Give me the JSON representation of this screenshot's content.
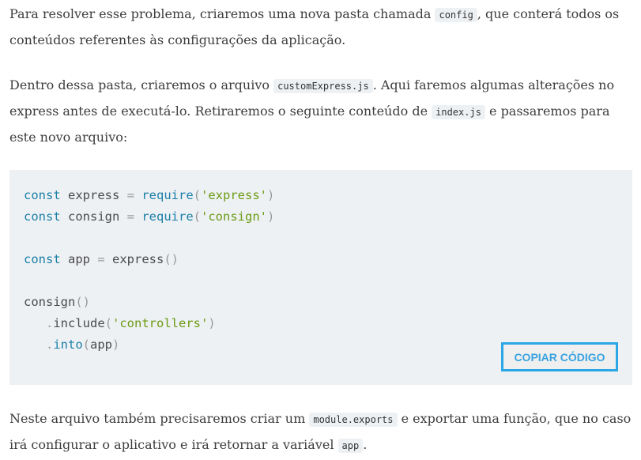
{
  "p1": {
    "a": "Para resolver esse problema, criaremos uma nova pasta chamada ",
    "c1": "config",
    "b": ", que conterá todos os conteúdos referentes às configurações da aplicação."
  },
  "p2": {
    "a": "Dentro dessa pasta, criaremos o arquivo ",
    "c1": "customExpress.js",
    "b": ". Aqui faremos algumas alterações no express antes de executá-lo. Retiraremos o seguinte conteúdo de ",
    "c2": "index.js",
    "c": " e passaremos para este novo arquivo:"
  },
  "code": [
    [
      [
        "kw",
        "const"
      ],
      [
        "",
        "  express "
      ],
      [
        "pun",
        "="
      ],
      [
        "",
        ""
      ],
      [
        "fn",
        " require"
      ],
      [
        "pun",
        "("
      ],
      [
        "str",
        "'express'"
      ],
      [
        "pun",
        ")"
      ]
    ],
    [
      [
        "kw",
        "const"
      ],
      [
        "",
        "  consign "
      ],
      [
        "pun",
        "="
      ],
      [
        "",
        ""
      ],
      [
        "fn",
        " require"
      ],
      [
        "pun",
        "("
      ],
      [
        "str",
        "'consign'"
      ],
      [
        "pun",
        ")"
      ]
    ],
    [],
    [
      [
        "kw",
        "const"
      ],
      [
        "",
        " app "
      ],
      [
        "pun",
        "="
      ],
      [
        "",
        " express"
      ],
      [
        "pun",
        "()"
      ]
    ],
    [],
    [
      [
        "",
        "consign"
      ],
      [
        "pun",
        "()"
      ]
    ],
    [
      [
        "pun",
        "    ."
      ],
      [
        "",
        "include"
      ],
      [
        "pun",
        "("
      ],
      [
        "str",
        "'controllers'"
      ],
      [
        "pun",
        ")"
      ]
    ],
    [
      [
        "pun",
        "    ."
      ],
      [
        "fn",
        "into"
      ],
      [
        "pun",
        "("
      ],
      [
        "",
        "app"
      ],
      [
        "pun",
        ")"
      ]
    ]
  ],
  "copy_label": "COPIAR CÓDIGO",
  "p3": {
    "a": "Neste arquivo também precisaremos criar um ",
    "c1": "module.exports",
    "b": " e exportar uma função, que no caso irá configurar o aplicativo e irá retornar a variável ",
    "c2": "app",
    "c": "."
  }
}
